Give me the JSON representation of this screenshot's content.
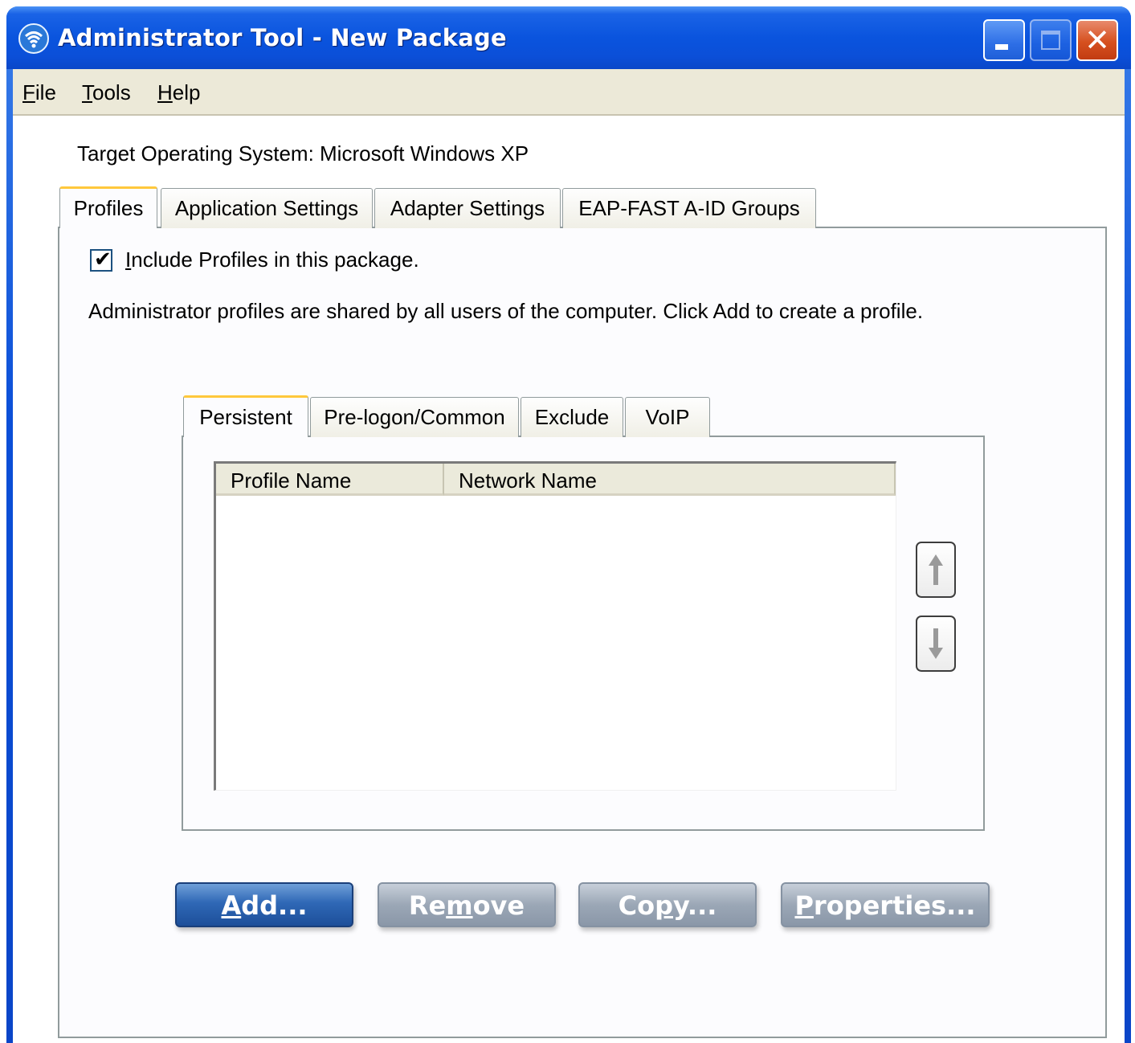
{
  "window": {
    "title": "Administrator Tool - New Package",
    "icon": "wireless-signal-icon"
  },
  "title_buttons": {
    "minimize": "minimize-icon",
    "maximize": "maximize-icon",
    "close": "close-icon"
  },
  "menu": {
    "items": [
      {
        "label": "File",
        "mnemonic": "F"
      },
      {
        "label": "Tools",
        "mnemonic": "T"
      },
      {
        "label": "Help",
        "mnemonic": "H"
      }
    ]
  },
  "target_os": "Target Operating System: Microsoft Windows XP",
  "main_tabs": [
    {
      "label": "Profiles",
      "active": true
    },
    {
      "label": "Application Settings",
      "active": false
    },
    {
      "label": "Adapter Settings",
      "active": false
    },
    {
      "label": "EAP-FAST A-ID Groups",
      "active": false
    }
  ],
  "profiles": {
    "include_checkbox": {
      "label": "Include Profiles in this package.",
      "checked": true
    },
    "description": "Administrator profiles are shared by all users of the computer. Click Add to create a profile.",
    "sub_tabs": [
      {
        "label": "Persistent",
        "active": true
      },
      {
        "label": "Pre-logon/Common",
        "active": false
      },
      {
        "label": "Exclude",
        "active": false
      },
      {
        "label": "VoIP",
        "active": false
      }
    ],
    "table": {
      "columns": [
        "Profile Name",
        "Network Name"
      ],
      "rows": []
    },
    "buttons": {
      "add": "Add...",
      "remove": "Remove",
      "copy": "Copy...",
      "properties": "Properties..."
    }
  },
  "colors": {
    "titlebar": "#0b4fd8",
    "menubar": "#ece9d8",
    "active_tab_highlight": "#ffc83c",
    "primary_button": "#2f68b6",
    "disabled_button": "#9ba7b6"
  }
}
